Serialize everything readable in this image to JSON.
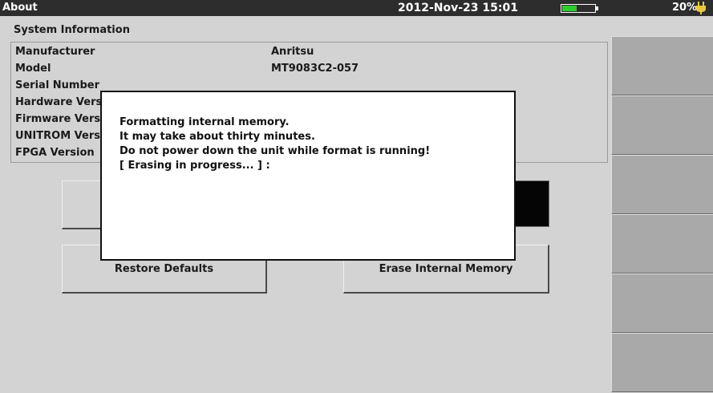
{
  "titlebar": {
    "title": "About",
    "datetime": "2012-Nov-23 15:01",
    "battery_level": 0.45,
    "battery_percent": "20%",
    "accent_color": "#2ecc2e",
    "charging_icon": "plug-icon"
  },
  "system_info": {
    "heading": "System Information",
    "rows": [
      {
        "label": "Manufacturer",
        "value": "Anritsu"
      },
      {
        "label": "Model",
        "value": "MT9083C2-057"
      },
      {
        "label": "Serial Number",
        "value": ""
      },
      {
        "label": "Hardware Vers",
        "value": ""
      },
      {
        "label": "Firmware Versi",
        "value": ""
      },
      {
        "label": "UNITROM Vers",
        "value": ""
      },
      {
        "label": "FPGA Version",
        "value": ""
      }
    ]
  },
  "buttons": {
    "restore_defaults": "Restore Defaults",
    "erase_internal_memory": "Erase Internal Memory"
  },
  "dialog": {
    "lines": [
      "Formatting internal memory.",
      "It may take about thirty minutes.",
      "Do not power down the unit while format is running!",
      "[ Erasing in progress... ] :"
    ]
  },
  "softkeys": [
    "",
    "",
    "",
    "",
    "",
    ""
  ]
}
